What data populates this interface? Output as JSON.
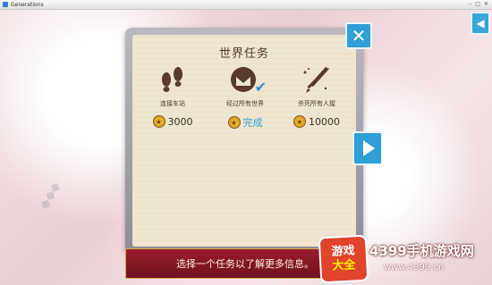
{
  "window": {
    "title": "Generations"
  },
  "panel": {
    "title": "世界任务",
    "quests": [
      {
        "name": "连接车站",
        "icon": "footprints-icon",
        "reward": "3000",
        "done": false
      },
      {
        "name": "经过所有世界",
        "icon": "envelope-check-icon",
        "reward": "完成",
        "done": true
      },
      {
        "name": "杀死所有人猩",
        "icon": "sword-icon",
        "reward": "10000",
        "done": false
      }
    ]
  },
  "info_bar": {
    "text": "选择一个任务以了解更多信息。"
  },
  "watermark": {
    "badge_top": "游戏",
    "badge_bottom": "大全",
    "site": "4399手机游戏网",
    "url": "www.4399.cn"
  },
  "colors": {
    "button_blue": "#2f9fd6",
    "info_bar_red": "#8a1626",
    "parchment": "#efe5d1"
  }
}
